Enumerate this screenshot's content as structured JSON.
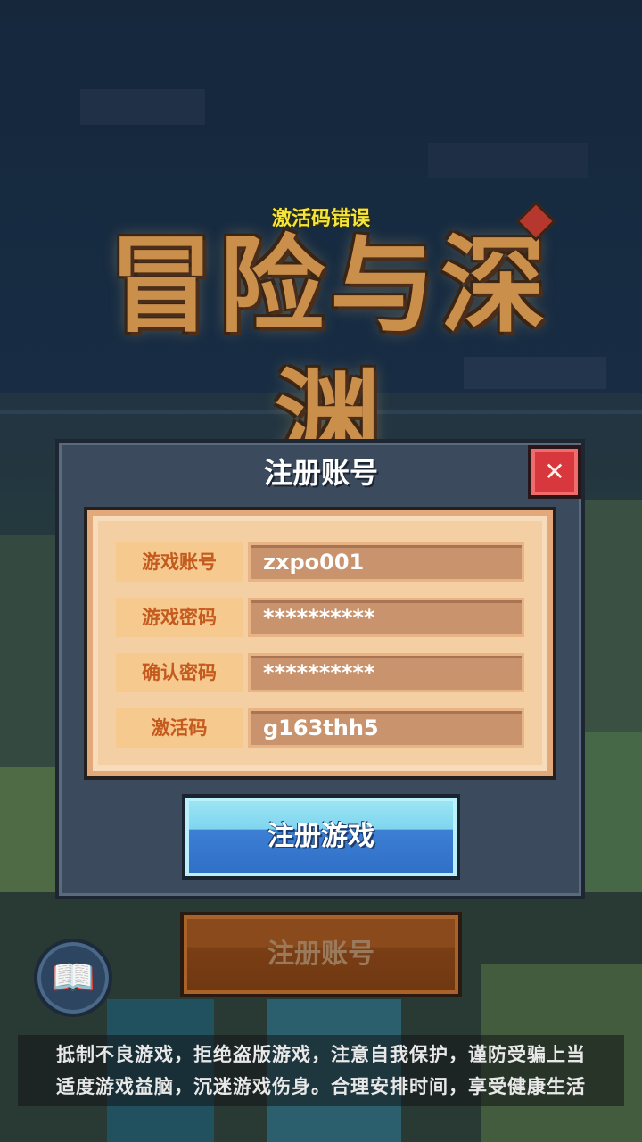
{
  "game": {
    "logo_text": "冒险与深渊",
    "error_message": "激活码错误"
  },
  "dialog": {
    "title": "注册账号",
    "close_icon": "close-icon",
    "fields": [
      {
        "label": "游戏账号",
        "value": "zxpo001"
      },
      {
        "label": "游戏密码",
        "value": "**********"
      },
      {
        "label": "确认密码",
        "value": "**********"
      },
      {
        "label": "激活码",
        "value": "g163thh5"
      }
    ],
    "submit_label": "注册游戏"
  },
  "secondary_button": "注册账号",
  "book_icon": "book-icon",
  "notice": {
    "line1": "抵制不良游戏，拒绝盗版游戏，注意自我保护，谨防受骗上当",
    "line2": "适度游戏益脑，沉迷游戏伤身。合理安排时间，享受健康生活"
  },
  "colors": {
    "error_text": "#f5e53a",
    "close_button": "#d8383d",
    "primary_button": "#3c7fd3",
    "label_text": "#c45a1e"
  }
}
